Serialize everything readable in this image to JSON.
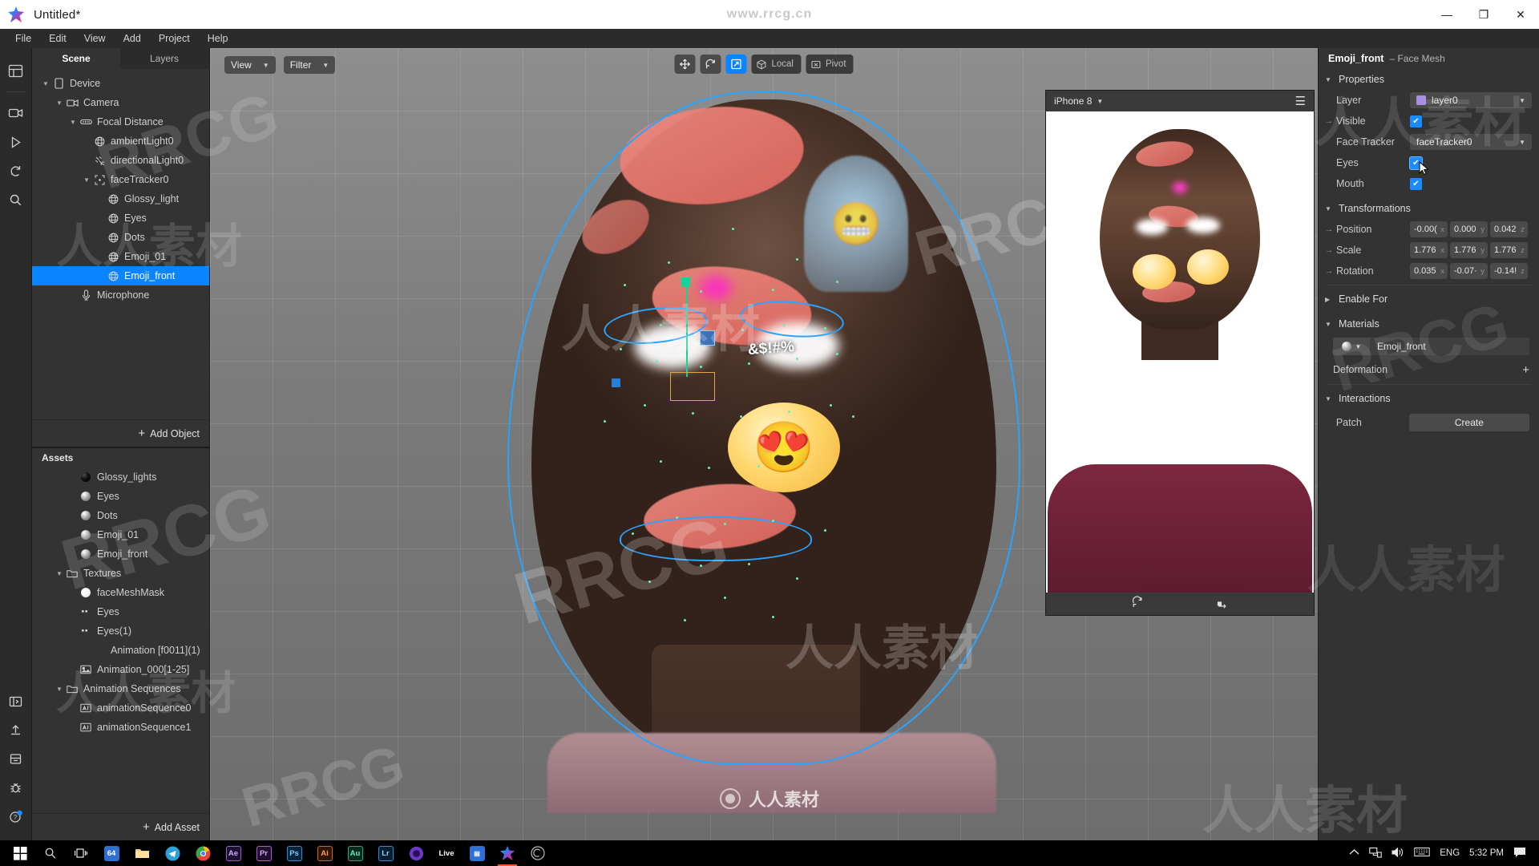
{
  "window": {
    "title": "Untitled*",
    "watermark_top": "www.rrcg.cn",
    "minimize": "—",
    "maximize": "❐",
    "close": "✕"
  },
  "menubar": [
    "File",
    "Edit",
    "View",
    "Add",
    "Project",
    "Help"
  ],
  "rail": {
    "top": [
      "layout-icon",
      "camera-icon",
      "play-icon",
      "refresh-icon",
      "search-icon"
    ],
    "bottom": [
      "panel-icon",
      "upload-icon",
      "export-icon",
      "bug-icon",
      "help-icon"
    ]
  },
  "scene_panel": {
    "tabs": [
      {
        "label": "Scene",
        "active": true
      },
      {
        "label": "Layers",
        "active": false
      }
    ],
    "tree": [
      {
        "label": "Device",
        "depth": 0,
        "icon": "device-icon",
        "caret": "down",
        "selected": false
      },
      {
        "label": "Camera",
        "depth": 1,
        "icon": "camera-icon",
        "caret": "down",
        "selected": false
      },
      {
        "label": "Focal Distance",
        "depth": 2,
        "icon": "focal-icon",
        "caret": "down",
        "selected": false
      },
      {
        "label": "ambientLight0",
        "depth": 3,
        "icon": "globe-icon",
        "caret": "none",
        "selected": false
      },
      {
        "label": "directionalLight0",
        "depth": 3,
        "icon": "dirlight-icon",
        "caret": "none",
        "selected": false
      },
      {
        "label": "faceTracker0",
        "depth": 3,
        "icon": "tracker-icon",
        "caret": "down",
        "selected": false
      },
      {
        "label": "Glossy_light",
        "depth": 4,
        "icon": "globe-icon",
        "caret": "none",
        "selected": false
      },
      {
        "label": "Eyes",
        "depth": 4,
        "icon": "globe-icon",
        "caret": "none",
        "selected": false
      },
      {
        "label": "Dots",
        "depth": 4,
        "icon": "globe-icon",
        "caret": "none",
        "selected": false
      },
      {
        "label": "Emoji_01",
        "depth": 4,
        "icon": "globe-icon",
        "caret": "none",
        "selected": false
      },
      {
        "label": "Emoji_front",
        "depth": 4,
        "icon": "globe-icon",
        "caret": "none",
        "selected": true
      },
      {
        "label": "Microphone",
        "depth": 2,
        "icon": "mic-icon",
        "caret": "none",
        "selected": false
      }
    ],
    "add_object_label": "Add Object"
  },
  "assets_panel": {
    "header": "Assets",
    "items": [
      {
        "label": "Glossy_lights",
        "depth": 2,
        "icon": "material-black-icon",
        "caret": "none"
      },
      {
        "label": "Eyes",
        "depth": 2,
        "icon": "material-icon",
        "caret": "none"
      },
      {
        "label": "Dots",
        "depth": 2,
        "icon": "material-icon",
        "caret": "none"
      },
      {
        "label": "Emoji_01",
        "depth": 2,
        "icon": "material-icon",
        "caret": "none"
      },
      {
        "label": "Emoji_front",
        "depth": 2,
        "icon": "material-icon",
        "caret": "none"
      },
      {
        "label": "Textures",
        "depth": 1,
        "icon": "folder-icon",
        "caret": "down"
      },
      {
        "label": "faceMeshMask",
        "depth": 2,
        "icon": "texture-white-icon",
        "caret": "none"
      },
      {
        "label": "Eyes",
        "depth": 2,
        "icon": "sequence-icon",
        "caret": "none"
      },
      {
        "label": "Eyes(1)",
        "depth": 2,
        "icon": "sequence-icon",
        "caret": "none"
      },
      {
        "label": "Animation [f0011](1)",
        "depth": 3,
        "icon": "none-icon",
        "caret": "none"
      },
      {
        "label": "Animation_000[1-25]",
        "depth": 2,
        "icon": "image-seq-icon",
        "caret": "none"
      },
      {
        "label": "Animation Sequences",
        "depth": 1,
        "icon": "folder-icon",
        "caret": "down"
      },
      {
        "label": "animationSequence0",
        "depth": 2,
        "icon": "anim-icon",
        "caret": "none"
      },
      {
        "label": "animationSequence1",
        "depth": 2,
        "icon": "anim-icon",
        "caret": "none"
      }
    ],
    "add_asset_label": "Add Asset"
  },
  "viewport": {
    "view_dropdown": "View",
    "filter_dropdown": "Filter",
    "tools": [
      {
        "name": "move-tool",
        "glyph": "✥",
        "active": false
      },
      {
        "name": "rotate-tool",
        "glyph": "↻",
        "active": false
      },
      {
        "name": "scale-tool",
        "glyph": "⧉",
        "active": true
      }
    ],
    "local_label": "Local",
    "pivot_label": "Pivot",
    "swear_overlay": "&$!#%"
  },
  "simulator": {
    "device": "iPhone 8",
    "menu_icon": "hamburger-icon",
    "footer_icons": [
      "reset-icon",
      "screenshot-icon"
    ]
  },
  "inspector": {
    "object_name": "Emoji_front",
    "object_type": "– Face Mesh",
    "sections": {
      "properties": "Properties",
      "transformations": "Transformations",
      "enable_for": "Enable For",
      "materials": "Materials",
      "interactions": "Interactions"
    },
    "properties": {
      "layer_label": "Layer",
      "layer_value": "layer0",
      "layer_color": "#a98fe0",
      "visible_label": "Visible",
      "visible_checked": true,
      "face_tracker_label": "Face Tracker",
      "face_tracker_value": "faceTracker0",
      "eyes_label": "Eyes",
      "eyes_checked": true,
      "mouth_label": "Mouth",
      "mouth_checked": true
    },
    "transformations": {
      "position_label": "Position",
      "position": [
        "-0.00(",
        "0.000",
        "0.042"
      ],
      "scale_label": "Scale",
      "scale": [
        "1.776",
        "1.776",
        "1.776"
      ],
      "rotation_label": "Rotation",
      "rotation": [
        "0.035",
        "-0.07·",
        "-0.14!"
      ],
      "axes": [
        "x",
        "y",
        "z"
      ]
    },
    "materials": {
      "material_name": "Emoji_front",
      "deformation_label": "Deformation",
      "deformation_add": "+"
    },
    "interactions": {
      "patch_label": "Patch",
      "create_label": "Create"
    },
    "accent_color": "#1a8cff"
  },
  "taskbar": {
    "apps": [
      {
        "name": "start-icon",
        "label": ""
      },
      {
        "name": "search-icon",
        "label": ""
      },
      {
        "name": "taskview-icon",
        "label": ""
      },
      {
        "name": "app-x64-icon",
        "label": "64"
      },
      {
        "name": "explorer-icon",
        "label": ""
      },
      {
        "name": "telegram-icon",
        "label": ""
      },
      {
        "name": "chrome-icon",
        "label": ""
      },
      {
        "name": "after-effects-icon",
        "label": "Ae"
      },
      {
        "name": "premiere-icon",
        "label": "Pr"
      },
      {
        "name": "photoshop-icon",
        "label": "Ps"
      },
      {
        "name": "illustrator-icon",
        "label": "Ai"
      },
      {
        "name": "audition-icon",
        "label": "Au"
      },
      {
        "name": "lightroom-icon",
        "label": "Lr"
      },
      {
        "name": "media-encoder-icon",
        "label": ""
      },
      {
        "name": "ableton-live-icon",
        "label": "Live"
      },
      {
        "name": "app-blue-icon",
        "label": ""
      },
      {
        "name": "spark-ar-icon",
        "label": ""
      },
      {
        "name": "spark-ar-player-icon",
        "label": ""
      }
    ],
    "tray": {
      "language": "ENG",
      "time": "5:32 PM",
      "icons": [
        "chevron-up-icon",
        "network-icon",
        "volume-icon",
        "keyboard-icon",
        "notification-icon"
      ]
    }
  },
  "watermarks": {
    "brand": "RRCG",
    "cn": "人人素材",
    "footer": "人人素材"
  }
}
